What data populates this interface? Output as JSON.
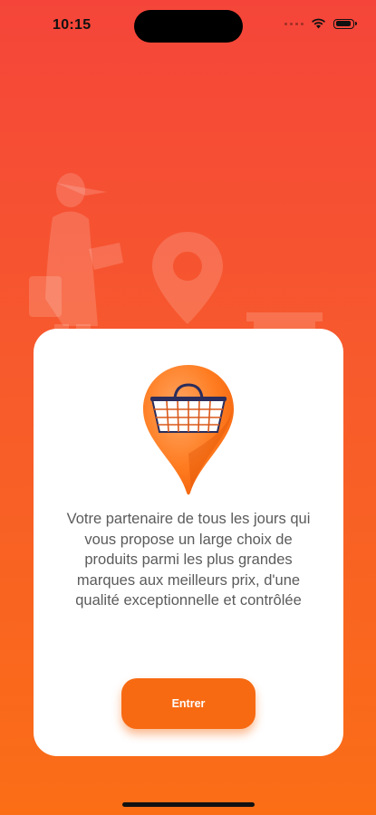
{
  "status_bar": {
    "time": "10:15",
    "battery_level": 0.9
  },
  "welcome_card": {
    "description": "Votre partenaire de tous les jours qui vous propose un large choix de produits parmi les plus grandes marques aux meilleurs prix, d'une qualité exceptionnelle et contrôlée",
    "enter_label": "Entrer"
  },
  "icons": {
    "logo": "basket-map-pin-icon",
    "background": [
      "delivery-person-icon",
      "location-pin-icon",
      "store-icon"
    ]
  },
  "colors": {
    "background_top": "#f5453a",
    "background_bottom": "#fb6e16",
    "accent": "#f76a12",
    "basket_outline": "#2b2d5c",
    "text": "#5b5b5b"
  }
}
